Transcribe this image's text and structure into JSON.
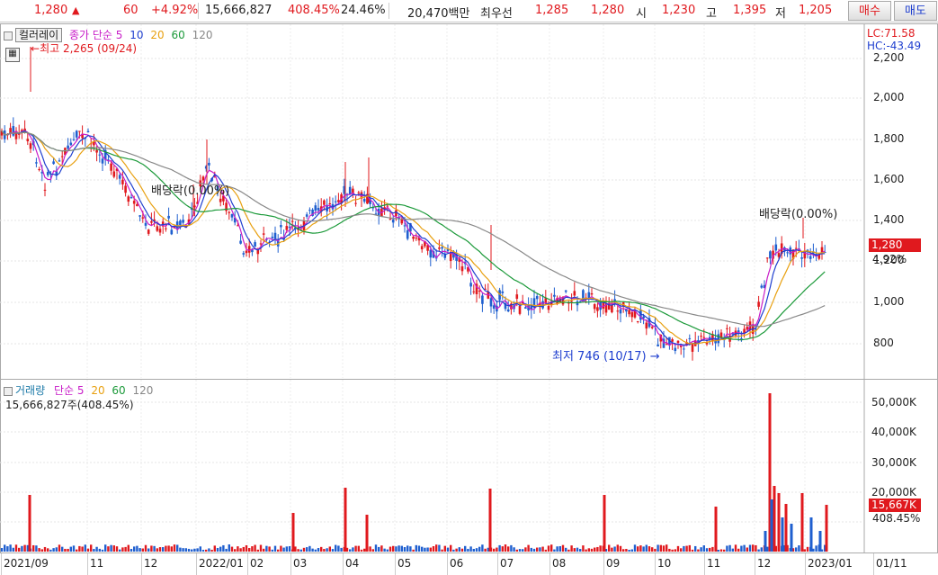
{
  "topbar": {
    "price": "1,280",
    "up_arrow": "▲",
    "change": "60",
    "change_pct": "+4.92%",
    "volume": "15,666,827",
    "volume_ratio": "408.45%",
    "turnover": "24.46%",
    "amount": "20,470백만",
    "best_label": "최우선",
    "best_ask": "1,285",
    "best_bid": "1,280",
    "open_label": "시",
    "open": "1,230",
    "high_label": "고",
    "high": "1,395",
    "low_label": "저",
    "low": "1,205",
    "buy_button": "매수",
    "sell_button": "매도"
  },
  "price_panel": {
    "color_ray": "컬러레이",
    "legend_ma_label": "종가 단순 5",
    "legend_ma": [
      "10",
      "20",
      "60",
      "120"
    ],
    "legend_colors": [
      "#c81ec8",
      "#1f3fcf",
      "#e8a010",
      "#1c9a3a",
      "#888888"
    ],
    "lc": "LC:71.58",
    "hc": "HC:-43.49",
    "max_annotation": "최고 2,265 (09/24)",
    "min_annotation": "최저 746 (10/17)",
    "dividend_1": "배당락(0.00%)",
    "dividend_2": "배당락(0.00%)",
    "y_ticks": [
      "2,200",
      "2,000",
      "1,800",
      "1,600",
      "1,400",
      "1,200",
      "1,000",
      "800"
    ],
    "price_tag": "1,280",
    "pct_tag": "4.92%"
  },
  "volume_panel": {
    "legend_title": "거래량",
    "legend_ma_label": "단순 5",
    "legend_ma": [
      "20",
      "60",
      "120"
    ],
    "volume_text": "15,666,827주(408.45%)",
    "y_ticks": [
      "50,000K",
      "40,000K",
      "30,000K",
      "20,000K"
    ],
    "volume_tag": "15,667K",
    "volume_pct_tag": "408.45%"
  },
  "date_axis": [
    "2021/09",
    "11",
    "12",
    "2022/01",
    "02",
    "03",
    "04",
    "05",
    "06",
    "07",
    "08",
    "09",
    "10",
    "11",
    "12",
    "2023/01",
    "01/11"
  ]
}
